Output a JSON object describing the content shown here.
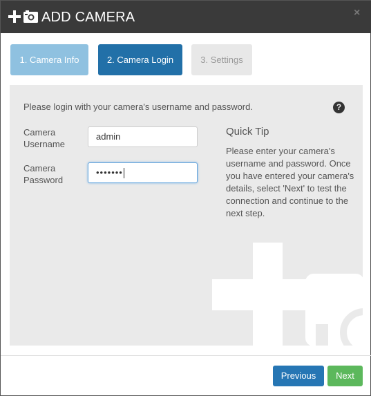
{
  "header": {
    "title": "ADD CAMERA",
    "close_glyph": "×",
    "icons": [
      "plus-icon",
      "camera-icon",
      "close-icon"
    ]
  },
  "steps": [
    {
      "label": "1. Camera Info",
      "state": "completed"
    },
    {
      "label": "2. Camera Login",
      "state": "active"
    },
    {
      "label": "3. Settings",
      "state": "disabled"
    }
  ],
  "form": {
    "intro": "Please login with your camera's username and password.",
    "help_glyph": "?",
    "username": {
      "label_line1": "Camera",
      "label_line2": "Username",
      "value": "admin"
    },
    "password": {
      "label_line1": "Camera",
      "label_line2": "Password",
      "masked_value": "•••••••"
    }
  },
  "tip": {
    "title": "Quick Tip",
    "body": "Please enter your camera's username and password. Once you have entered your camera's details, select 'Next' to test the connection and continue to the next step."
  },
  "footer": {
    "previous_label": "Previous",
    "next_label": "Next"
  },
  "colors": {
    "header_bg": "#3a3a3a",
    "step_completed": "#8fc1e0",
    "step_active": "#2270a8",
    "step_disabled": "#e8e8e8",
    "panel_bg": "#eaeaea",
    "previous_button": "#2676b4",
    "next_button": "#5cb85c"
  }
}
